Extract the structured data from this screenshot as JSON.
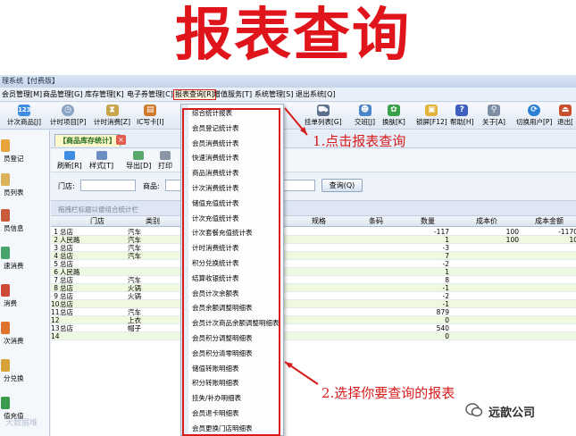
{
  "banner": {
    "title": "报表查询"
  },
  "window": {
    "title": "理系统【付费版】"
  },
  "menubar": {
    "items": [
      "会员管理[M]",
      "商品管理[G]",
      "库存管理[K]",
      "电子券管理[C]",
      "报表查询[R]",
      "增值服务[T]",
      "系统管理[S]",
      "退出系统[Q]"
    ]
  },
  "toolbar": {
    "items": [
      {
        "label": "计次商品[J]",
        "icon": "123"
      },
      {
        "label": "计时项目[P]",
        "icon": "clock"
      },
      {
        "label": "计时消费[Z]",
        "icon": "hourglass"
      },
      {
        "label": "IC写卡[I]",
        "icon": "card"
      },
      {
        "label": "挂单列表[G]",
        "icon": "cart"
      },
      {
        "label": "交班[J]",
        "icon": "people"
      },
      {
        "label": "换肤[K]",
        "icon": "skin"
      },
      {
        "label": "锁屏[F12]",
        "icon": "lock"
      },
      {
        "label": "帮助[H]",
        "icon": "help"
      },
      {
        "label": "关于[A]",
        "icon": "search"
      },
      {
        "label": "切换用户[P]",
        "icon": "switch-user"
      },
      {
        "label": "退出[",
        "icon": "exit"
      }
    ]
  },
  "sidebar": {
    "items": [
      "员登记",
      "员列表",
      "员信息",
      "速消费",
      "消费",
      "次消费",
      "分兑换",
      "值充值"
    ]
  },
  "tab": {
    "label": "【商品库存统计】",
    "close": "×"
  },
  "subtoolbar": {
    "items": [
      "刷新[R]",
      "样式[T]",
      "导出[D]",
      "打印"
    ]
  },
  "filter": {
    "store_label": "门店:",
    "store_value": "",
    "product_label": "商品:",
    "product_value": "",
    "query_button": "查询(Q)"
  },
  "grouping_hint": "拖拽栏标题以便组合统计栏",
  "table": {
    "columns": [
      "门店",
      "类别",
      "规格",
      "条码",
      "数量",
      "成本价",
      "成本金额"
    ],
    "rows": [
      {
        "no": "1",
        "store": "总店",
        "category": "汽车",
        "qty": "-117",
        "cost": "100",
        "amount": "-1170"
      },
      {
        "no": "2",
        "store": "人民路",
        "category": "汽车",
        "qty": "1",
        "cost": "100",
        "amount": "10"
      },
      {
        "no": "3",
        "store": "总店",
        "category": "汽车",
        "qty": "-3",
        "cost": "",
        "amount": ""
      },
      {
        "no": "4",
        "store": "总店",
        "category": "汽车",
        "qty": "7",
        "cost": "",
        "amount": ""
      },
      {
        "no": "5",
        "store": "总店",
        "category": "",
        "qty": "-2",
        "cost": "",
        "amount": ""
      },
      {
        "no": "6",
        "store": "人民路",
        "category": "",
        "qty": "1",
        "cost": "",
        "amount": ""
      },
      {
        "no": "7",
        "store": "总店",
        "category": "汽车",
        "qty": "8",
        "cost": "",
        "amount": ""
      },
      {
        "no": "8",
        "store": "总店",
        "category": "火锅",
        "qty": "-1",
        "cost": "",
        "amount": ""
      },
      {
        "no": "9",
        "store": "总店",
        "category": "火锅",
        "qty": "-2",
        "cost": "",
        "amount": ""
      },
      {
        "no": "10",
        "store": "总店",
        "category": "",
        "qty": "-1",
        "cost": "",
        "amount": ""
      },
      {
        "no": "11",
        "store": "总店",
        "category": "汽车",
        "qty": "879",
        "cost": "",
        "amount": ""
      },
      {
        "no": "12",
        "store": "",
        "category": "上衣",
        "qty": "0",
        "cost": "",
        "amount": ""
      },
      {
        "no": "13",
        "store": "总店",
        "category": "帽子",
        "qty": "540",
        "cost": "",
        "amount": ""
      },
      {
        "no": "14",
        "store": "",
        "category": "",
        "qty": "0",
        "cost": "",
        "amount": ""
      }
    ]
  },
  "report_menu": {
    "items": [
      "综合统计报表",
      "会员登记统计表",
      "会员消费统计表",
      "快速消费统计表",
      "商品消费统计表",
      "计次消费统计表",
      "储值充值统计表",
      "计次充值统计表",
      "计次套餐充值统计表",
      "计时消费统计表",
      "积分兑换统计表",
      "结算收银统计表",
      "会员计次余额表",
      "会员余额调整明细表",
      "会员计次商品余额调整明细表",
      "会员积分调整明细表",
      "会员积分清零明细表",
      "储值转账明细表",
      "积分转账明细表",
      "挂失/补办明细表",
      "会员退卡明细表",
      "会员更换门店明细表"
    ]
  },
  "annotations": {
    "step1": "1.点击报表查询",
    "step2": "2.选择你要查询的报表"
  },
  "watermark": {
    "text": "远歆公司",
    "corner_text": "大数据堆"
  },
  "colors": {
    "accent_red": "#d81b1b",
    "banner_red": "#e0141b",
    "row_alt": "#eef9df"
  }
}
